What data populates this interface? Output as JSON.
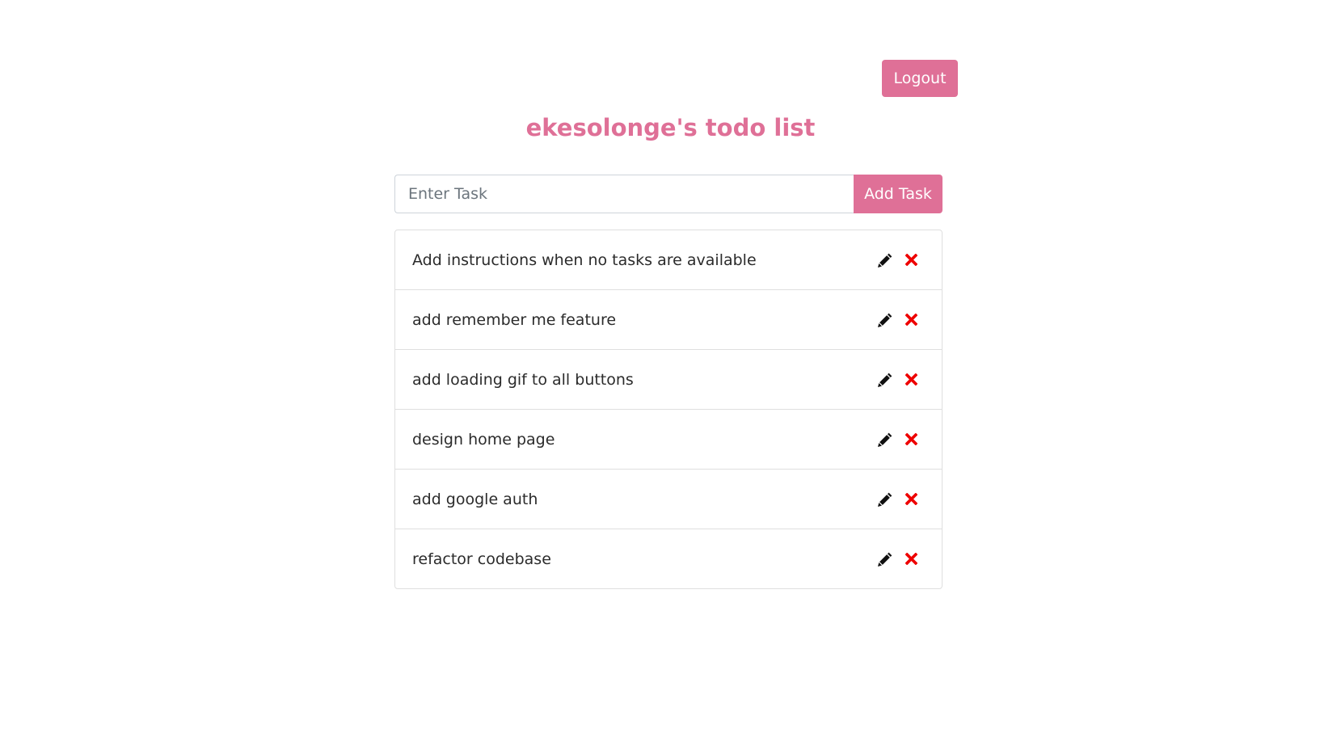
{
  "colors": {
    "accent": "#df7097",
    "delete": "#ee0000",
    "edit": "#111111"
  },
  "header": {
    "logout_label": "Logout",
    "title": "ekesolonge's todo list"
  },
  "add_task": {
    "placeholder": "Enter Task",
    "value": "",
    "button_label": "Add Task"
  },
  "tasks": [
    {
      "text": "Add instructions when no tasks are available",
      "edit_icon": "pencil-icon",
      "delete_icon": "close-icon"
    },
    {
      "text": "add remember me feature",
      "edit_icon": "pencil-icon",
      "delete_icon": "close-icon"
    },
    {
      "text": "add loading gif to all buttons",
      "edit_icon": "pencil-icon",
      "delete_icon": "close-icon"
    },
    {
      "text": "design home page",
      "edit_icon": "pencil-icon",
      "delete_icon": "close-icon"
    },
    {
      "text": "add google auth",
      "edit_icon": "pencil-icon",
      "delete_icon": "close-icon"
    },
    {
      "text": "refactor codebase",
      "edit_icon": "pencil-icon",
      "delete_icon": "close-icon"
    }
  ]
}
